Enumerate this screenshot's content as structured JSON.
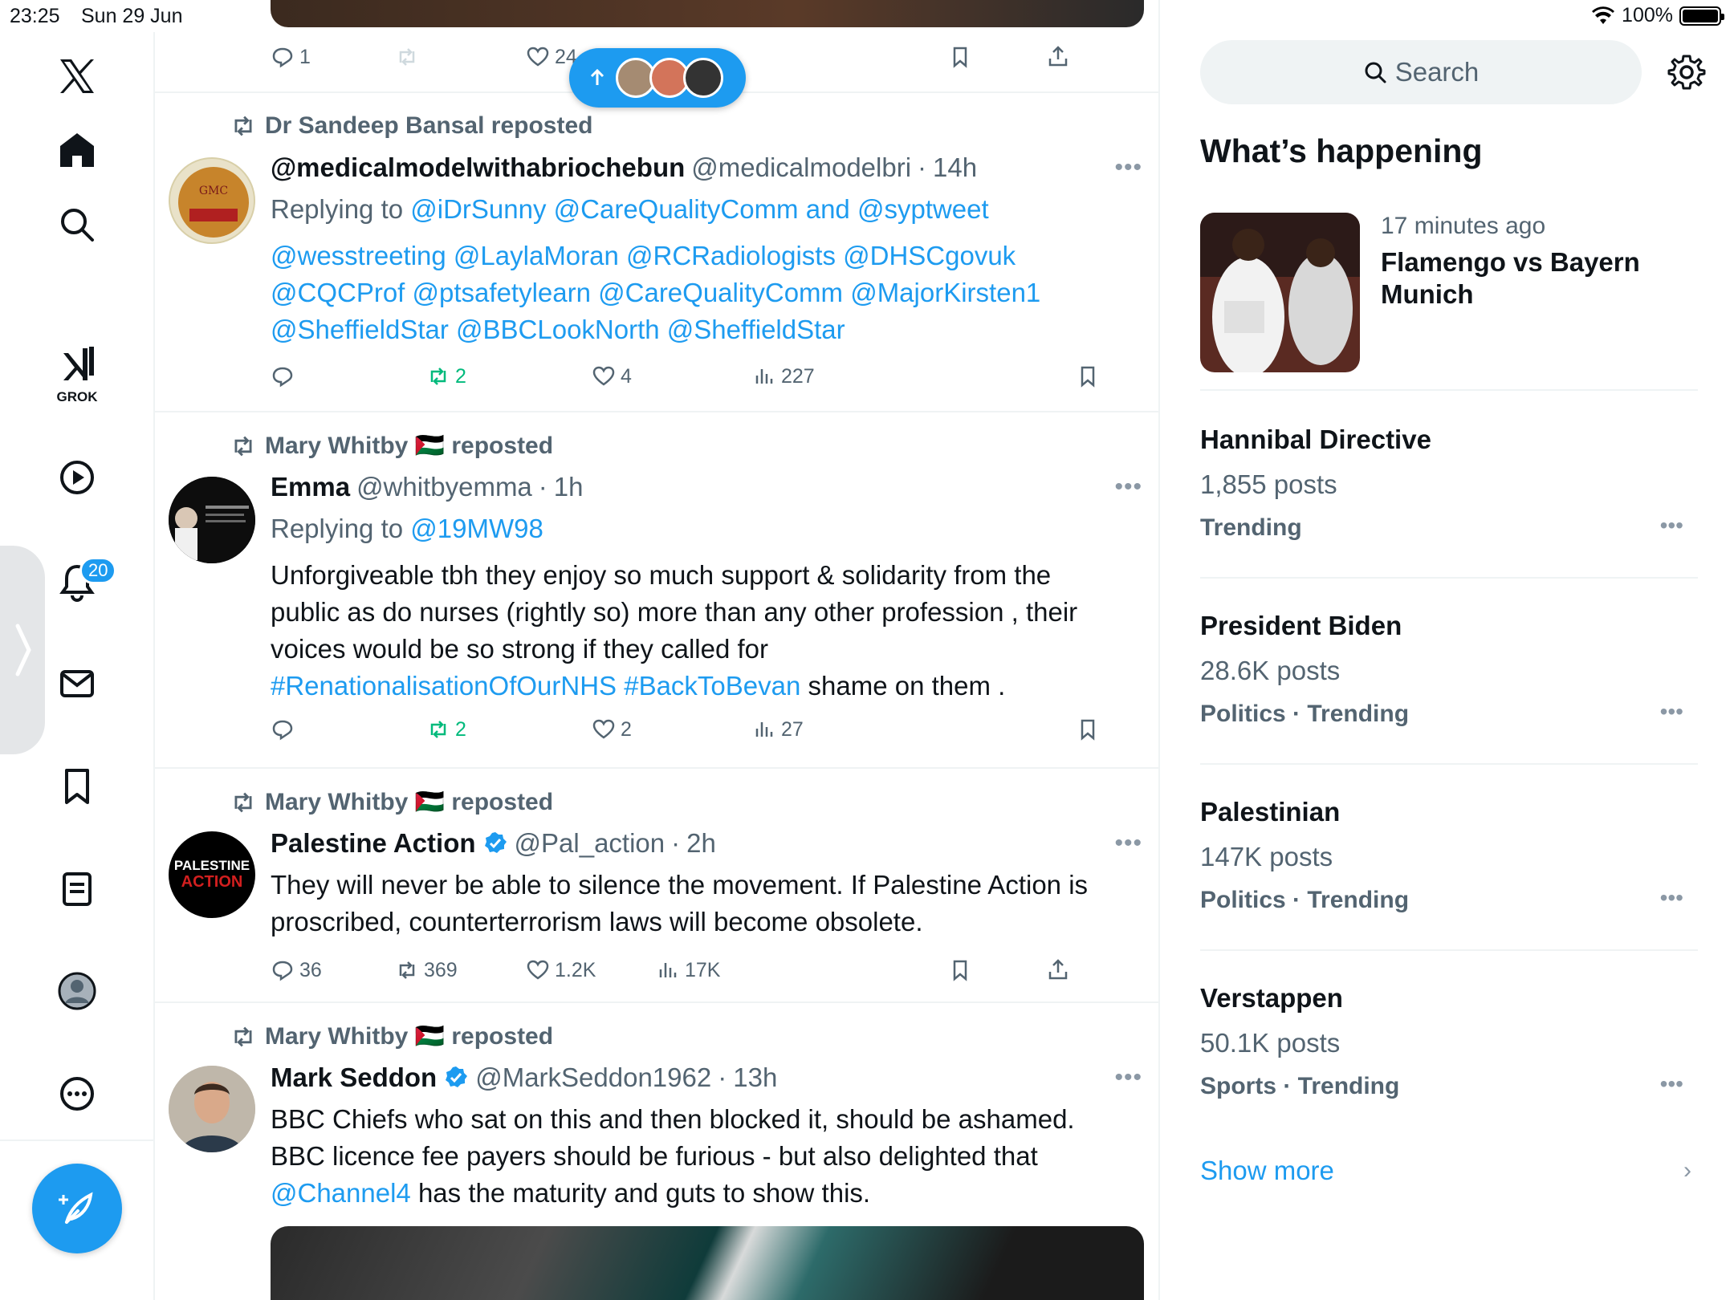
{
  "status_bar": {
    "time": "23:25",
    "date": "Sun 29 Jun",
    "battery": "100%",
    "battery_level": 1.0
  },
  "nav": {
    "grok_label": "GROK",
    "notifications_badge": "20"
  },
  "floating_pill": {
    "icon": "arrow-up-icon"
  },
  "top_partial_post": {
    "replies": "1",
    "likes": "24"
  },
  "posts": [
    {
      "repost_by": "Dr Sandeep Bansal reposted",
      "name": "@medicalmodelwithabriochebun",
      "handle": "@medicalmodelbri",
      "time": "14h",
      "reply_prefix": "Replying to ",
      "reply_to": "@iDrSunny @CareQualityComm and @syptweet",
      "body_lines": [
        "@wesstreeting @LaylaMoran @RCRadiologists @DHSCgovuk",
        "@CQCProf @ptsafetylearn @CareQualityComm @MajorKirsten1",
        "@SheffieldStar @BBCLookNorth @SheffieldStar"
      ],
      "replies": "",
      "reposts": "2",
      "likes": "4",
      "views": "227"
    },
    {
      "repost_by": "Mary Whitby 🇵🇸 reposted",
      "name": "Emma",
      "handle": "@whitbyemma",
      "time": "1h",
      "reply_prefix": "Replying to ",
      "reply_to": "@19MW98",
      "body_lines": [
        "Unforgiveable tbh they enjoy so much support & solidarity from the",
        "public as do nurses (rightly so) more than any other profession , their",
        "voices would be so strong if they called for"
      ],
      "hashtags": "#RenationalisationOfOurNHS #BackToBevan",
      "body_tail": " shame on them .",
      "replies": "",
      "reposts": "2",
      "likes": "2",
      "views": "27"
    },
    {
      "repost_by": "Mary Whitby 🇵🇸 reposted",
      "name": "Palestine Action",
      "handle": "@Pal_action",
      "time": "2h",
      "body_lines": [
        "They will never be able to silence the movement. If Palestine Action is",
        "proscribed, counterterrorism laws will become obsolete."
      ],
      "avatar_text_1": "PALESTINE",
      "avatar_text_2": "ACTION",
      "replies": "36",
      "reposts": "369",
      "likes": "1.2K",
      "views": "17K"
    },
    {
      "repost_by": "Mary Whitby 🇵🇸 reposted",
      "name": "Mark Seddon",
      "handle": "@MarkSeddon1962",
      "time": "13h",
      "body_lines": [
        "BBC Chiefs who sat on this and then blocked it, should be ashamed.",
        "BBC licence fee payers should be furious - but also delighted that"
      ],
      "mention": "@Channel4",
      "body_tail": " has the maturity and guts to show this."
    }
  ],
  "right": {
    "search_placeholder": "Search",
    "section_title": "What’s happening",
    "news": {
      "time": "17 minutes ago",
      "title": "Flamengo vs Bayern Munich"
    },
    "trends": [
      {
        "title": "Hannibal Directive",
        "count": "1,855 posts",
        "category": "Trending"
      },
      {
        "title": "President Biden",
        "count": "28.6K posts",
        "category": "Politics · Trending"
      },
      {
        "title": "Palestinian",
        "count": "147K posts",
        "category": "Politics · Trending"
      },
      {
        "title": "Verstappen",
        "count": "50.1K posts",
        "category": "Sports · Trending"
      }
    ],
    "show_more": "Show more"
  },
  "colors": {
    "accent": "#1d9bf0",
    "repost_green": "#00ba7c",
    "secondary_text": "#536471"
  }
}
